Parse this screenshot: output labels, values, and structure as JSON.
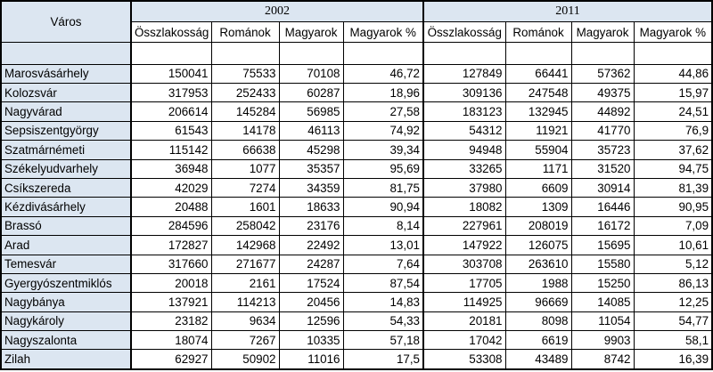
{
  "table": {
    "city_header": "Város",
    "years": [
      "2002",
      "2011"
    ],
    "columns": [
      "Összlakosság",
      "Románok",
      "Magyarok",
      "Magyarok %"
    ],
    "rows": [
      {
        "city": "Marosvásárhely",
        "y2002": [
          "150041",
          "75533",
          "70108",
          "46,72"
        ],
        "y2011": [
          "127849",
          "66441",
          "57362",
          "44,86"
        ]
      },
      {
        "city": "Kolozsvár",
        "y2002": [
          "317953",
          "252433",
          "60287",
          "18,96"
        ],
        "y2011": [
          "309136",
          "247548",
          "49375",
          "15,97"
        ]
      },
      {
        "city": "Nagyvárad",
        "y2002": [
          "206614",
          "145284",
          "56985",
          "27,58"
        ],
        "y2011": [
          "183123",
          "132945",
          "44892",
          "24,51"
        ]
      },
      {
        "city": "Sepsiszentgyörgy",
        "y2002": [
          "61543",
          "14178",
          "46113",
          "74,92"
        ],
        "y2011": [
          "54312",
          "11921",
          "41770",
          "76,9"
        ]
      },
      {
        "city": "Szatmárnémeti",
        "y2002": [
          "115142",
          "66638",
          "45298",
          "39,34"
        ],
        "y2011": [
          "94948",
          "55904",
          "35723",
          "37,62"
        ]
      },
      {
        "city": "Székelyudvarhely",
        "y2002": [
          "36948",
          "1077",
          "35357",
          "95,69"
        ],
        "y2011": [
          "33265",
          "1171",
          "31520",
          "94,75"
        ]
      },
      {
        "city": "Csíkszereda",
        "y2002": [
          "42029",
          "7274",
          "34359",
          "81,75"
        ],
        "y2011": [
          "37980",
          "6609",
          "30914",
          "81,39"
        ]
      },
      {
        "city": "Kézdivásárhely",
        "y2002": [
          "20488",
          "1601",
          "18633",
          "90,94"
        ],
        "y2011": [
          "18082",
          "1309",
          "16446",
          "90,95"
        ]
      },
      {
        "city": "Brassó",
        "y2002": [
          "284596",
          "258042",
          "23176",
          "8,14"
        ],
        "y2011": [
          "227961",
          "208019",
          "16172",
          "7,09"
        ]
      },
      {
        "city": "Arad",
        "y2002": [
          "172827",
          "142968",
          "22492",
          "13,01"
        ],
        "y2011": [
          "147922",
          "126075",
          "15695",
          "10,61"
        ]
      },
      {
        "city": "Temesvár",
        "y2002": [
          "317660",
          "271677",
          "24287",
          "7,64"
        ],
        "y2011": [
          "303708",
          "263610",
          "15580",
          "5,12"
        ]
      },
      {
        "city": "Gyergyószentmiklós",
        "y2002": [
          "20018",
          "2161",
          "17524",
          "87,54"
        ],
        "y2011": [
          "17705",
          "1988",
          "15250",
          "86,13"
        ]
      },
      {
        "city": "Nagybánya",
        "y2002": [
          "137921",
          "114213",
          "20456",
          "14,83"
        ],
        "y2011": [
          "114925",
          "96669",
          "14085",
          "12,25"
        ]
      },
      {
        "city": "Nagykároly",
        "y2002": [
          "23182",
          "9634",
          "12596",
          "54,33"
        ],
        "y2011": [
          "20181",
          "8098",
          "11054",
          "54,77"
        ]
      },
      {
        "city": "Nagyszalonta",
        "y2002": [
          "18074",
          "7267",
          "10335",
          "57,18"
        ],
        "y2011": [
          "17042",
          "6619",
          "9903",
          "58,1"
        ]
      },
      {
        "city": "Zilah",
        "y2002": [
          "62927",
          "50902",
          "11016",
          "17,5"
        ],
        "y2011": [
          "53308",
          "43489",
          "8742",
          "16,39"
        ]
      }
    ]
  },
  "colors": {
    "header_fill": "#dce6f1",
    "grid": "#000000"
  }
}
